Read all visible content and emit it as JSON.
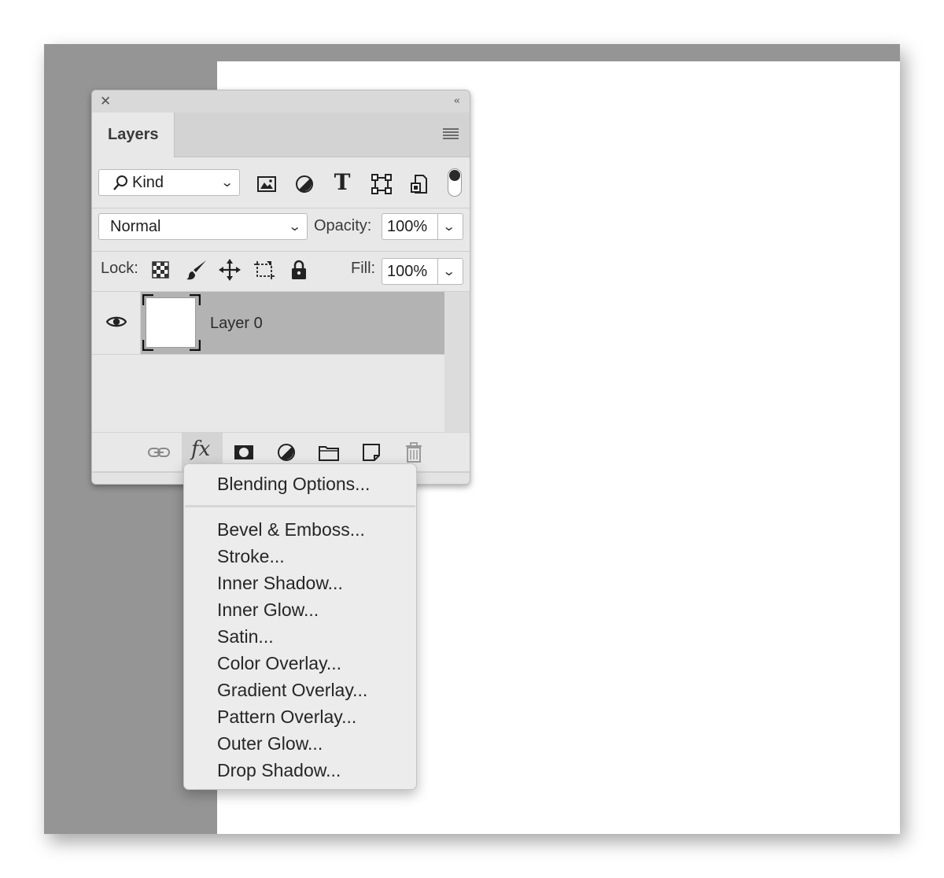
{
  "panel": {
    "tab_label": "Layers",
    "close_icon": "close-icon",
    "collapse_glyph": "‹‹"
  },
  "filter": {
    "kind_label": "Kind",
    "icons": [
      "image-filter-icon",
      "adjustment-filter-icon",
      "type-filter-icon",
      "shape-filter-icon",
      "smart-object-filter-icon"
    ],
    "type_glyph": "T"
  },
  "blend": {
    "mode": "Normal",
    "opacity_label": "Opacity:",
    "opacity_value": "100%"
  },
  "lock": {
    "label": "Lock:",
    "fill_label": "Fill:",
    "fill_value": "100%"
  },
  "layers": [
    {
      "name": "Layer 0",
      "visible": true,
      "selected": true
    }
  ],
  "bottom_bar": {
    "fx_label": "fx",
    "icons": [
      "link-icon",
      "fx-icon",
      "mask-icon",
      "adjustment-icon",
      "folder-icon",
      "new-layer-icon",
      "trash-icon"
    ]
  },
  "fx_menu": {
    "items": [
      "Blending Options...",
      "Bevel & Emboss...",
      "Stroke...",
      "Inner Shadow...",
      "Inner Glow...",
      "Satin...",
      "Color Overlay...",
      "Gradient Overlay...",
      "Pattern Overlay...",
      "Outer Glow...",
      "Drop Shadow..."
    ]
  },
  "colors": {
    "workspace": "#959595",
    "panel": "#e8e8e8",
    "selected_layer": "#b3b3b3",
    "document": "#ffffff"
  }
}
